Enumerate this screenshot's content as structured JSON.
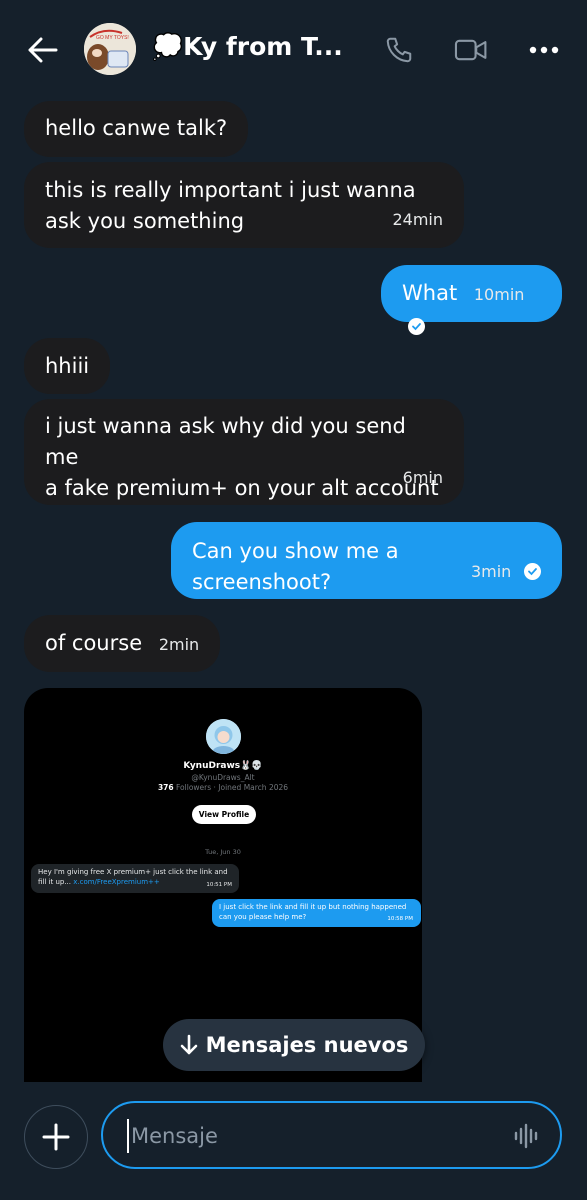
{
  "header": {
    "title": "💭Ky from T...",
    "avatar_text": "GO MY TOYS!"
  },
  "messages": [
    {
      "dir": "in",
      "text": "hello canwe talk?",
      "time": ""
    },
    {
      "dir": "in",
      "line1": "this is really important i just wanna",
      "line2": "ask you something",
      "time": "24min"
    },
    {
      "dir": "out",
      "text": "What",
      "time": "10min"
    },
    {
      "dir": "in",
      "text": "hhiii",
      "time": ""
    },
    {
      "dir": "in",
      "line1": "i just wanna ask why did you send me",
      "line2": "a fake premium+ on your alt account",
      "time": "6min"
    },
    {
      "dir": "out",
      "text": "Can you show me a screenshoot?",
      "time": "3min"
    },
    {
      "dir": "in",
      "text": "of course",
      "time": "2min"
    }
  ],
  "screenshot": {
    "name": "KynuDraws🐰💀",
    "handle": "@KynuDraws_Alt",
    "followers_count": "376",
    "followers_label": "Followers · Joined March 2026",
    "view_profile": "View Profile",
    "date": "Tue, Jun 30",
    "in_line1": "Hey I'm giving free X premium+ just click the link and",
    "in_line2": "fill it up...",
    "in_link": "x.com/FreeXpremium++",
    "in_time": "10:51 PM",
    "out_line1": "I just click the link and fill it up but nothing happened",
    "out_line2": "can you please help me?",
    "out_time": "10:58 PM"
  },
  "new_messages": "Mensajes nuevos",
  "composer": {
    "placeholder": "Mensaje"
  },
  "colors": {
    "background": "#15202b",
    "incoming_bubble": "#1c1c1e",
    "outgoing_bubble": "#1d9bf0",
    "accent": "#1d9bf0"
  },
  "icons": [
    "back-arrow-icon",
    "phone-icon",
    "video-camera-icon",
    "more-icon",
    "check-circle-icon",
    "arrow-down-icon",
    "plus-icon",
    "voice-wave-icon"
  ]
}
